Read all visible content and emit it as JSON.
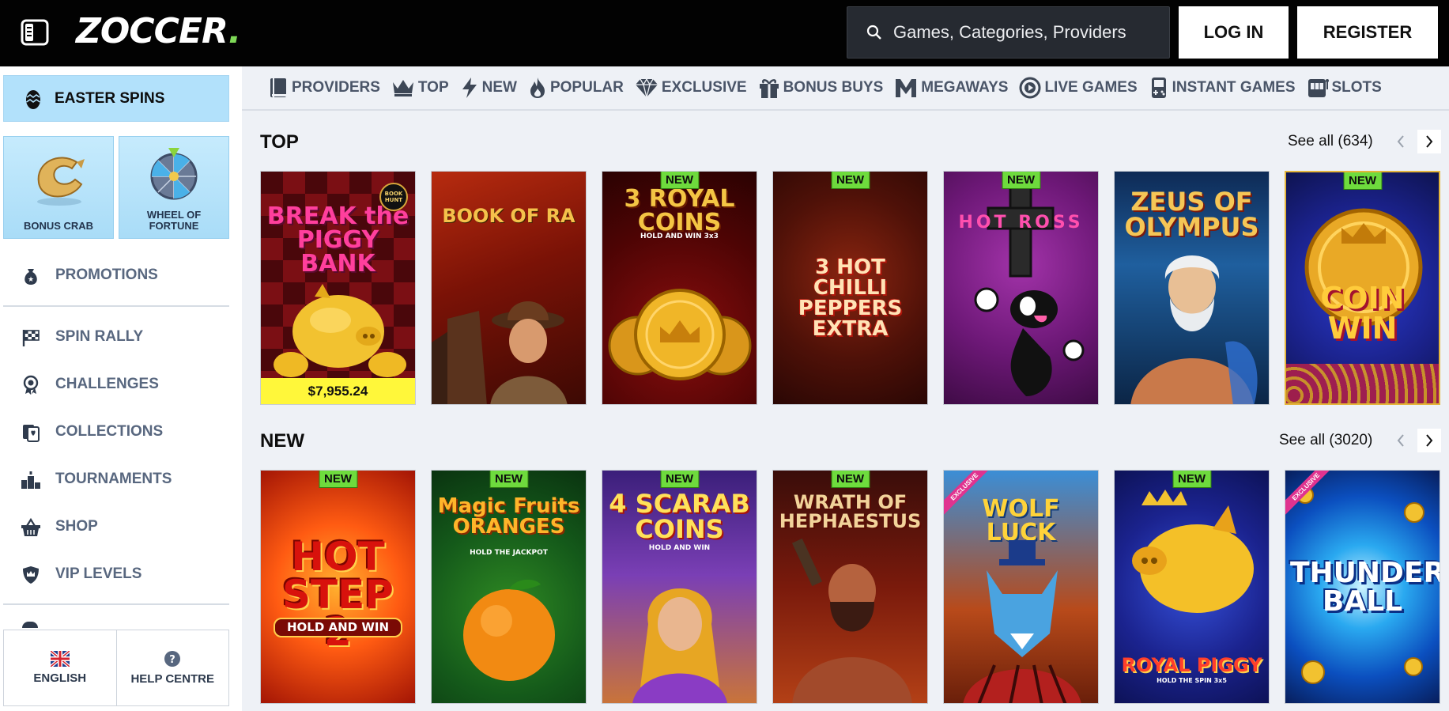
{
  "header": {
    "logo_main": "ZOCCER",
    "search_placeholder": "Games, Categories, Providers",
    "login_label": "LOG IN",
    "register_label": "REGISTER"
  },
  "sidebar": {
    "easter_label": "EASTER SPINS",
    "tiles": [
      {
        "label": "BONUS CRAB"
      },
      {
        "label_line1": "WHEEL OF",
        "label_line2": "FORTUNE"
      }
    ],
    "items": [
      {
        "label": "PROMOTIONS"
      },
      {
        "label": "SPIN RALLY"
      },
      {
        "label": "CHALLENGES"
      },
      {
        "label": "COLLECTIONS"
      },
      {
        "label": "TOURNAMENTS"
      },
      {
        "label": "SHOP"
      },
      {
        "label": "VIP LEVELS"
      }
    ],
    "footer": {
      "language_label": "ENGLISH",
      "help_label": "HELP CENTRE"
    }
  },
  "categories": [
    {
      "label": "PROVIDERS",
      "icon": "book-icon"
    },
    {
      "label": "TOP",
      "icon": "crown-icon"
    },
    {
      "label": "NEW",
      "icon": "lightning-icon"
    },
    {
      "label": "POPULAR",
      "icon": "flame-icon"
    },
    {
      "label": "EXCLUSIVE",
      "icon": "diamond-icon"
    },
    {
      "label": "BONUS BUYS",
      "icon": "gift-icon"
    },
    {
      "label": "MEGAWAYS",
      "icon": "megaways-icon"
    },
    {
      "label": "LIVE GAMES",
      "icon": "live-icon"
    },
    {
      "label": "INSTANT GAMES",
      "icon": "gamepad-icon"
    },
    {
      "label": "SLOTS",
      "icon": "slot-machine-icon"
    }
  ],
  "sections": {
    "top": {
      "title": "TOP",
      "see_all": "See all (634)",
      "games": [
        {
          "title": "BREAK the PIGGY BANK",
          "jackpot": "$7,955.24",
          "badge": "",
          "corner": "BOOK HUNT"
        },
        {
          "title": "BOOK OF RA",
          "badge": ""
        },
        {
          "title": "3 ROYAL COINS",
          "subtitle": "HOLD AND WIN 3x3",
          "badge": "NEW"
        },
        {
          "title": "3 HOT CHILLI PEPPERS EXTRA",
          "badge": "NEW"
        },
        {
          "title": "HOT ROSS",
          "badge": "NEW"
        },
        {
          "title": "ZEUS OF OLYMPUS",
          "badge": ""
        },
        {
          "title": "COIN WIN",
          "badge": "NEW"
        }
      ]
    },
    "new": {
      "title": "NEW",
      "see_all": "See all (3020)",
      "games": [
        {
          "title": "HOT STEP 2",
          "subtitle": "HOLD AND WIN",
          "badge": "NEW"
        },
        {
          "title": "Magic Fruits ORANGES",
          "subtitle": "HOLD THE JACKPOT",
          "badge": "NEW"
        },
        {
          "title": "4 SCARAB COINS",
          "subtitle": "HOLD AND WIN",
          "badge": "NEW"
        },
        {
          "title": "WRATH OF HEPHAESTUS",
          "badge": "NEW"
        },
        {
          "title": "WOLF LUCK",
          "ribbon": "EXCLUSIVE"
        },
        {
          "title": "ROYAL PIGGY",
          "subtitle": "HOLD THE SPIN 3x5",
          "badge": "NEW"
        },
        {
          "title": "THUNDER BALL",
          "ribbon": "EXCLUSIVE"
        }
      ]
    }
  }
}
